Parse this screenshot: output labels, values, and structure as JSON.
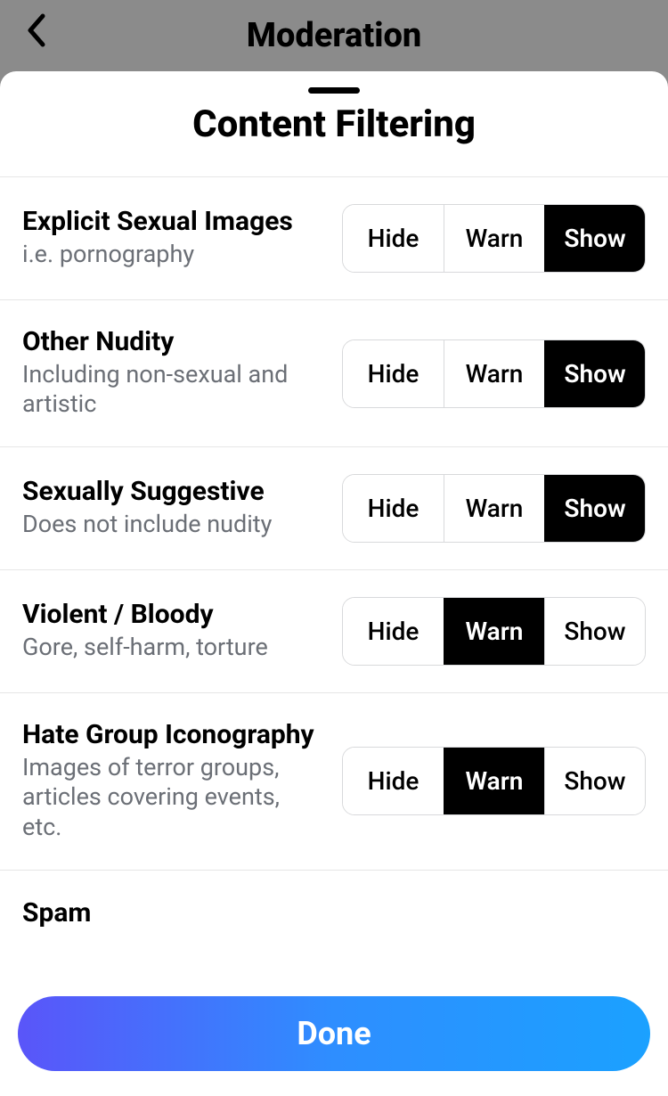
{
  "header": {
    "title": "Moderation"
  },
  "sheet": {
    "title": "Content Filtering",
    "options": {
      "hide": "Hide",
      "warn": "Warn",
      "show": "Show"
    },
    "filters": [
      {
        "title": "Explicit Sexual Images",
        "desc": "i.e. pornography",
        "selected": "show"
      },
      {
        "title": "Other Nudity",
        "desc": "Including non-sexual and artistic",
        "selected": "show"
      },
      {
        "title": "Sexually Suggestive",
        "desc": "Does not include nudity",
        "selected": "show"
      },
      {
        "title": "Violent / Bloody",
        "desc": "Gore, self-harm, torture",
        "selected": "warn"
      },
      {
        "title": "Hate Group Iconography",
        "desc": "Images of terror groups, articles covering events, etc.",
        "selected": "warn"
      }
    ],
    "next_partial": "Spam",
    "done": "Done"
  }
}
